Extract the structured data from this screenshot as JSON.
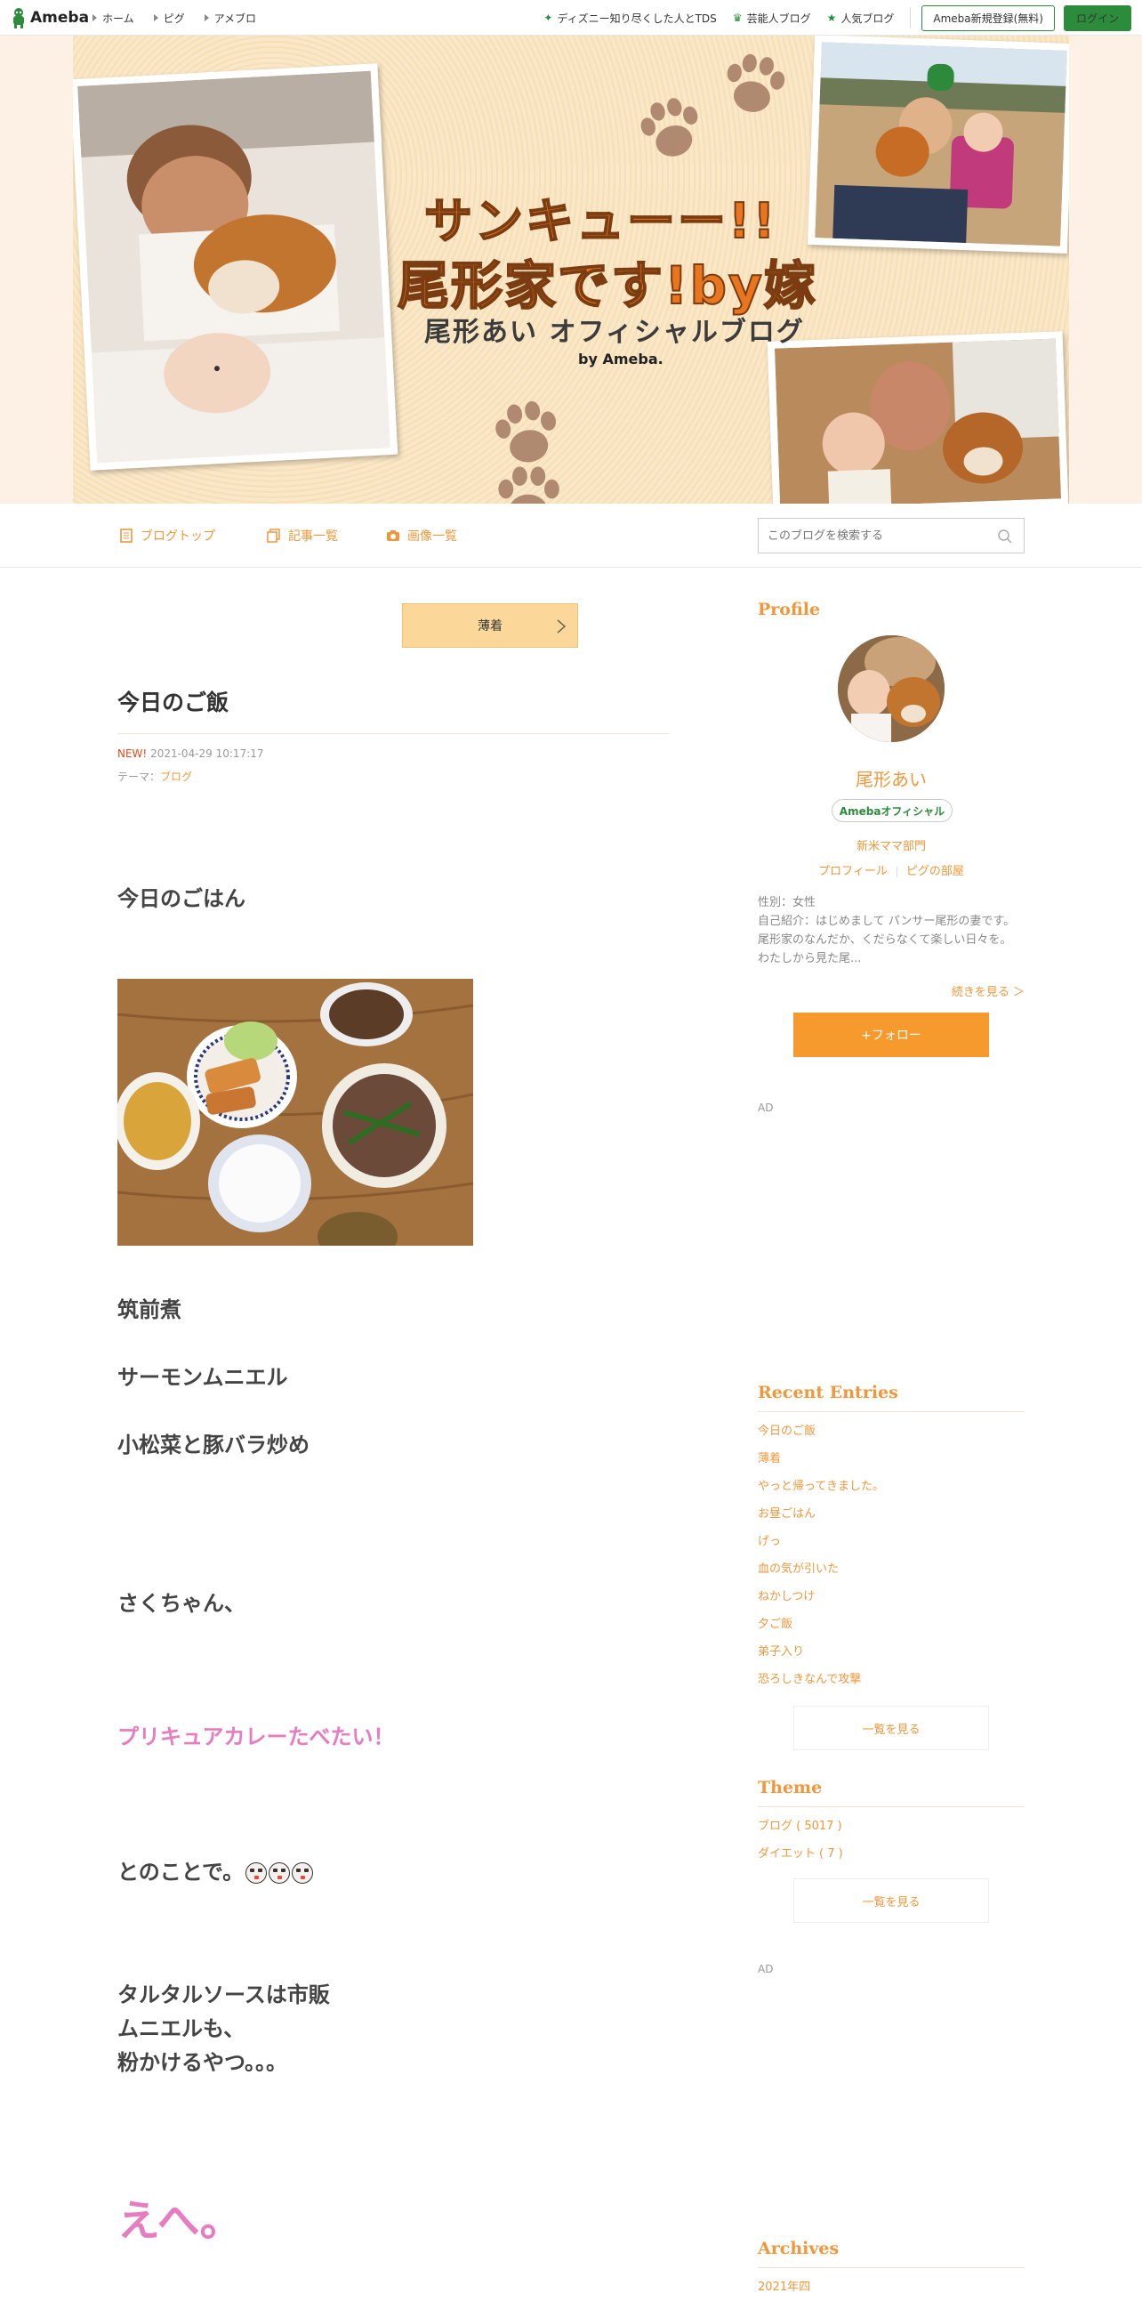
{
  "topbar": {
    "logo": "Ameba",
    "nav": [
      "ホーム",
      "ピグ",
      "アメブロ"
    ],
    "right_links": [
      "ディズニー知り尽くした人とTDS",
      "芸能人ブログ",
      "人気ブログ"
    ],
    "register": "Ameba新規登録(無料)",
    "login": "ログイン"
  },
  "banner": {
    "title_line1": "サンキューー!!",
    "title_line2": "尾形家です!by嫁",
    "subtitle": "尾形あい オフィシャルブログ",
    "by": "by Ameba."
  },
  "blognav": {
    "items": [
      "ブログトップ",
      "記事一覧",
      "画像一覧"
    ],
    "search_placeholder": "このブログを検索する"
  },
  "article": {
    "prev_label": "薄着",
    "title": "今日のご飯",
    "new_badge": "NEW!",
    "datetime": "2021-04-29 10:17:17",
    "theme_label": "テーマ：",
    "theme": "ブログ",
    "lines": {
      "l1": "今日のごはん",
      "l2": "筑前煮",
      "l3": "サーモンムニエル",
      "l4": "小松菜と豚バラ炒め",
      "l5": "さくちゃん、",
      "l6": "プリキュアカレーたべたい！",
      "l7": "とのことで。",
      "l8a": "タルタルソースは市販",
      "l8b": "ムニエルも、",
      "l8c": "粉かけるやつ。。。",
      "l9": "えへ。"
    }
  },
  "sidebar": {
    "profile_heading": "Profile",
    "name": "尾形あい",
    "badge": "Amebaオフィシャル",
    "category": "新米ママ部門",
    "profile_link": "プロフィール",
    "pig_link": "ピグの部屋",
    "desc": "性別：女性\n自己紹介：はじめまして パンサー尾形の妻です。 尾形家のなんだか、くだらなくて楽しい日々を。 わたしから見た尾...",
    "more": "続きを見る ＞",
    "follow": "+フォロー",
    "ad1": "AD",
    "recent_heading": "Recent Entries",
    "recent": [
      "今日のご飯",
      "薄着",
      "やっと帰ってきました。",
      "お昼ごはん",
      "げっ",
      "血の気が引いた",
      "ねかしつけ",
      "夕ご飯",
      "弟子入り",
      "恐ろしきなんで攻撃"
    ],
    "list_more": "一覧を見る",
    "theme_heading": "Theme",
    "themes": [
      "ブログ ( 5017 )",
      "ダイエット ( 7 )"
    ],
    "theme_more": "一覧を見る",
    "ad2": "AD",
    "archives_heading": "Archives",
    "archive_first": "2021年四"
  },
  "colors": {
    "accent": "#f0973b",
    "ameba_green": "#2d8c3c",
    "pink_text": "#e87cc0",
    "new_red": "#e04a1a"
  }
}
